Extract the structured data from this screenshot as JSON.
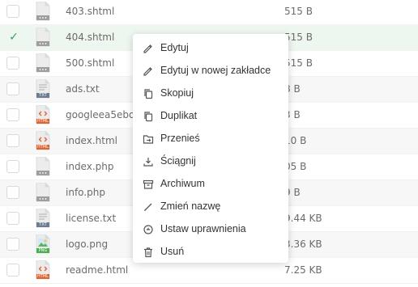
{
  "files": [
    {
      "name": "403.shtml",
      "size": "515 B",
      "type": "generic",
      "selected": false
    },
    {
      "name": "404.shtml",
      "size": "515 B",
      "type": "generic",
      "selected": true
    },
    {
      "name": "500.shtml",
      "size": "515 B",
      "type": "generic",
      "selected": false
    },
    {
      "name": "ads.txt",
      "size": "8 B",
      "type": "txt",
      "selected": false
    },
    {
      "name": "googleea5ebd",
      "size": "3 B",
      "type": "html",
      "selected": false
    },
    {
      "name": "index.html",
      "size": "10 B",
      "type": "html",
      "selected": false
    },
    {
      "name": "index.php",
      "size": "05 B",
      "type": "generic",
      "selected": false
    },
    {
      "name": "info.php",
      "size": "9 B",
      "type": "generic",
      "selected": false
    },
    {
      "name": "license.txt",
      "size": "9.44 KB",
      "type": "txt",
      "selected": false
    },
    {
      "name": "logo.png",
      "size": "3.36 KB",
      "type": "png",
      "selected": false
    },
    {
      "name": "readme.html",
      "size": "7.25 KB",
      "type": "html",
      "selected": false
    }
  ],
  "check_glyph": "✓",
  "icon_labels": {
    "txt": "TXT",
    "html": "HTML",
    "png": "PNG"
  },
  "icon_colors": {
    "txt": "#6b7d8f",
    "html": "#e0622e",
    "png": "#4caf50",
    "generic": "#9e9e9e"
  },
  "context_menu": {
    "items": [
      {
        "label": "Edytuj",
        "icon": "edit-icon"
      },
      {
        "label": "Edytuj w nowej zakładce",
        "icon": "edit-new-tab-icon"
      },
      {
        "label": "Skopiuj",
        "icon": "copy-icon"
      },
      {
        "label": "Duplikat",
        "icon": "duplicate-icon"
      },
      {
        "label": "Przenieś",
        "icon": "move-icon"
      },
      {
        "label": "Ściągnij",
        "icon": "download-icon"
      },
      {
        "label": "Archiwum",
        "icon": "archive-icon"
      },
      {
        "label": "Zmień nazwę",
        "icon": "rename-icon"
      },
      {
        "label": "Ustaw uprawnienia",
        "icon": "permissions-icon"
      },
      {
        "label": "Usuń",
        "icon": "trash-icon"
      }
    ]
  }
}
